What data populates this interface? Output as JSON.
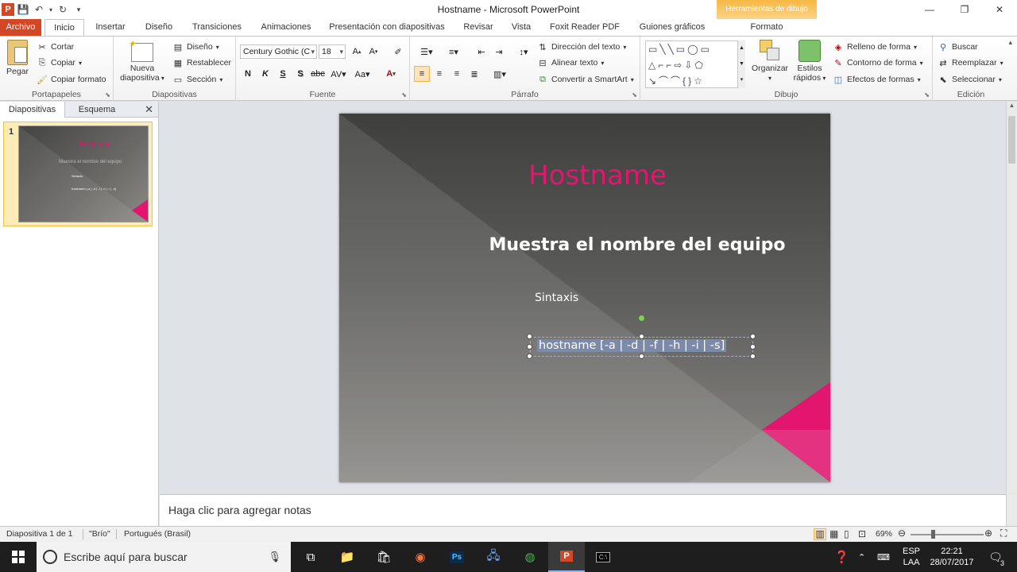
{
  "titlebar": {
    "title": "Hostname  -  Microsoft PowerPoint",
    "contextual_group": "Herramientas de dibujo",
    "app_logo": "P"
  },
  "tabs": [
    "Archivo",
    "Inicio",
    "Insertar",
    "Diseño",
    "Transiciones",
    "Animaciones",
    "Presentación con diapositivas",
    "Revisar",
    "Vista",
    "Foxit Reader PDF",
    "Guiones gráficos",
    "Formato"
  ],
  "ribbon": {
    "clipboard": {
      "paste": "Pegar",
      "cut": "Cortar",
      "copy": "Copiar",
      "format_painter": "Copiar formato",
      "label": "Portapapeles"
    },
    "slides": {
      "new_slide_1": "Nueva",
      "new_slide_2": "diapositiva",
      "layout": "Diseño",
      "reset": "Restablecer",
      "section": "Sección",
      "label": "Diapositivas"
    },
    "font": {
      "font_name": "Century Gothic (C",
      "font_size": "18",
      "bold": "N",
      "italic": "K",
      "underline": "S",
      "shadow": "S",
      "strike": "abc",
      "label": "Fuente"
    },
    "paragraph": {
      "text_direction": "Dirección del texto",
      "align_text": "Alinear texto",
      "smartart": "Convertir a SmartArt",
      "label": "Párrafo"
    },
    "drawing": {
      "arrange": "Organizar",
      "quick_styles_1": "Estilos",
      "quick_styles_2": "rápidos",
      "shape_fill": "Relleno de forma",
      "shape_outline": "Contorno de forma",
      "shape_effects": "Efectos de formas",
      "label": "Dibujo"
    },
    "editing": {
      "find": "Buscar",
      "replace": "Reemplazar",
      "select": "Seleccionar",
      "label": "Edición"
    }
  },
  "left_pane": {
    "tab_slides": "Diapositivas",
    "tab_outline": "Esquema",
    "thumb_number": "1",
    "thumb": {
      "title": "Hostname",
      "subtitle": "Muestra el nombre del equipo",
      "syntax": "Sintaxis",
      "command": "hostname [-a | -d | -f | -h | -i | -s]"
    }
  },
  "slide": {
    "title": "Hostname",
    "subtitle": "Muestra el nombre del equipo",
    "syntax_label": "Sintaxis",
    "command": "hostname [-a | -d | -f | -h | -i | -s]"
  },
  "notes": {
    "placeholder": "Haga clic para agregar notas"
  },
  "status": {
    "slide_info": "Diapositiva 1 de 1",
    "theme": "\"Brío\"",
    "language": "Portugués (Brasil)",
    "zoom": "69%"
  },
  "taskbar": {
    "search_placeholder": "Escribe aquí para buscar",
    "lang_1": "ESP",
    "lang_2": "LAA",
    "time": "22:21",
    "date": "28/07/2017",
    "notif_count": "3"
  },
  "colors": {
    "accent_file_tab": "#d24726",
    "slide_title": "#e2166f",
    "contextual": "#f7b843"
  }
}
